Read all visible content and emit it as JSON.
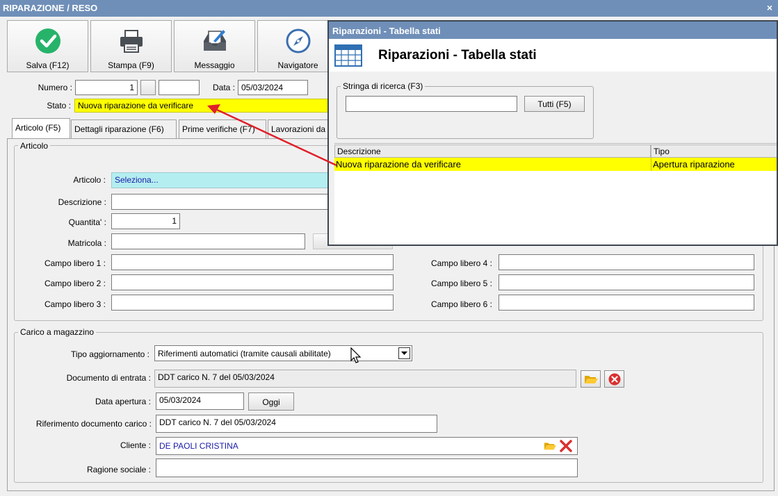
{
  "window": {
    "title": "RIPARAZIONE / RESO",
    "close": "×"
  },
  "toolbar": {
    "save": "Salva (F12)",
    "print": "Stampa (F9)",
    "message": "Messaggio",
    "navigator": "Navigatore"
  },
  "header": {
    "numero_label": "Numero :",
    "numero_value": "1",
    "data_label": "Data :",
    "data_value": "05/03/2024",
    "stato_label": "Stato :",
    "stato_value": "Nuova riparazione da verificare"
  },
  "tabs": [
    {
      "label": "Articolo (F5)"
    },
    {
      "label": "Dettagli riparazione (F6)"
    },
    {
      "label": "Prime verifiche (F7)"
    },
    {
      "label": "Lavorazioni da"
    }
  ],
  "articolo": {
    "group_title": "Articolo",
    "articolo_label": "Articolo :",
    "articolo_value": "Seleziona...",
    "descrizione_label": "Descrizione :",
    "quantita_label": "Quantita' :",
    "quantita_value": "1",
    "matricola_label": "Matricola :",
    "campi": [
      {
        "label": "Campo libero 1 :"
      },
      {
        "label": "Campo libero 2 :"
      },
      {
        "label": "Campo libero 3 :"
      },
      {
        "label": "Campo libero 4 :"
      },
      {
        "label": "Campo libero 5 :"
      },
      {
        "label": "Campo libero 6 :"
      }
    ]
  },
  "carico": {
    "group_title": "Carico a magazzino",
    "tipo_label": "Tipo aggiornamento :",
    "tipo_value": "Riferimenti automatici (tramite causali abilitate)",
    "documento_label": "Documento di entrata :",
    "documento_value": "DDT carico N. 7 del 05/03/2024",
    "data_apertura_label": "Data apertura :",
    "data_apertura_value": "05/03/2024",
    "oggi_button": "Oggi",
    "riferimento_label": "Riferimento documento carico :",
    "riferimento_value": "DDT carico N. 7 del 05/03/2024",
    "cliente_label": "Cliente :",
    "cliente_value": "DE PAOLI CRISTINA",
    "ragione_label": "Ragione sociale :"
  },
  "popup": {
    "title": "Riparazioni - Tabella stati",
    "heading": "Riparazioni - Tabella stati",
    "search_group": "Stringa di ricerca (F3)",
    "search_value": "",
    "all_button": "Tutti (F5)",
    "columns": [
      "Descrizione",
      "Tipo"
    ],
    "rows": [
      [
        "Nuova riparazione da verificare",
        "Apertura riparazione"
      ]
    ]
  },
  "colors": {
    "titlebar": "#6f8fb8",
    "highlight_yellow": "#ffff00",
    "articolo_select_bg": "#b4eef0",
    "link_blue": "#1a1aa8",
    "arrow_red": "#e0202a"
  }
}
